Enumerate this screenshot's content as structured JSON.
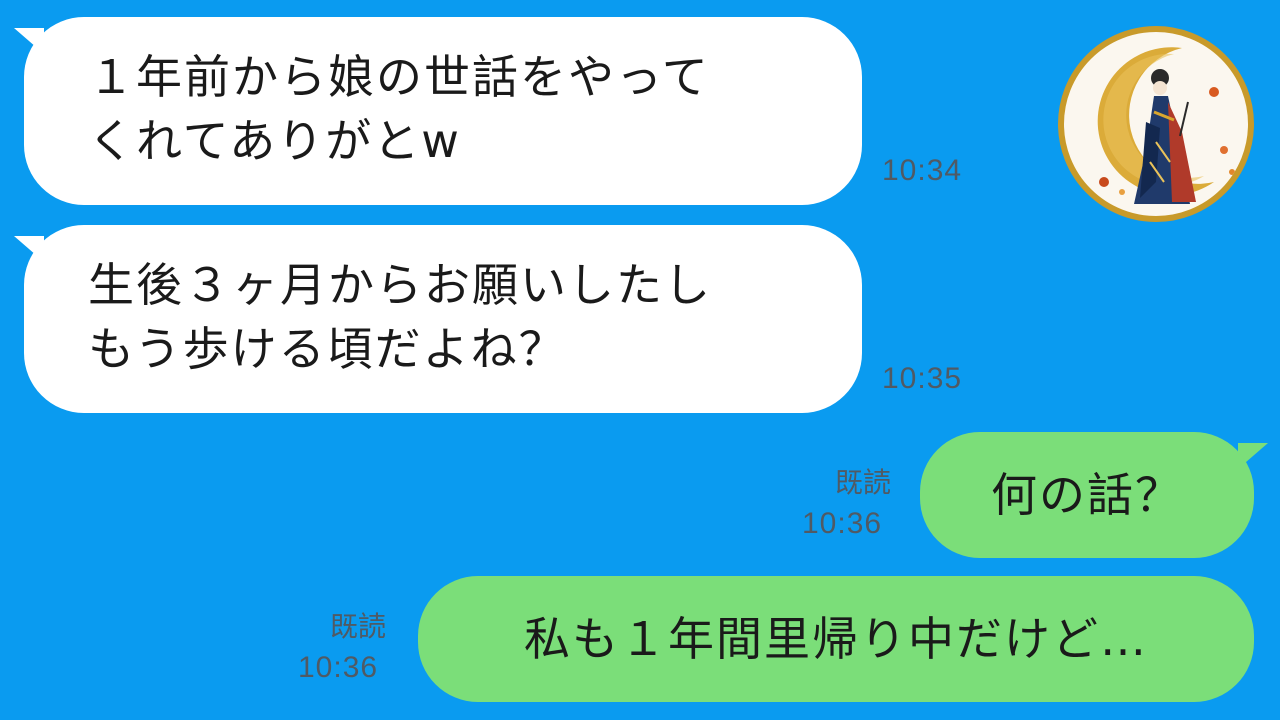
{
  "messages": [
    {
      "text": "１年前から娘の世話をやって\nくれてありがとw",
      "time": "10:34"
    },
    {
      "text": "生後３ヶ月からお願いしたし\nもう歩ける頃だよね？",
      "time": "10:35"
    },
    {
      "text": "何の話？",
      "read": "既読",
      "time": "10:36"
    },
    {
      "text": "私も１年間里帰り中だけど…",
      "read": "既読",
      "time": "10:36"
    }
  ],
  "colors": {
    "background": "#0a9bf0",
    "incoming_bubble": "#ffffff",
    "outgoing_bubble": "#7bde79",
    "meta_text": "#505a64"
  },
  "icons": {
    "avatar": "avatar-kimono-woman-crescent-moon"
  }
}
